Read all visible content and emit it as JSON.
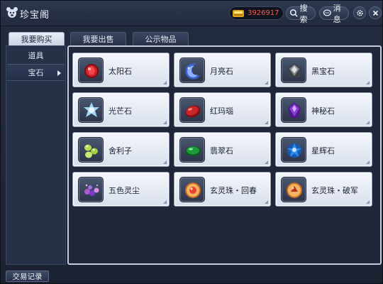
{
  "window": {
    "title": "珍宝阁"
  },
  "currency": {
    "value": "3926917",
    "icon": "gold-ingot-icon"
  },
  "header": {
    "search_label": "搜索",
    "message_label": "消息",
    "settings_icon": "gear-icon",
    "close_icon": "close-icon"
  },
  "tabs": [
    {
      "label": "我要购买",
      "active": true
    },
    {
      "label": "我要出售",
      "active": false
    },
    {
      "label": "公示物品",
      "active": false
    }
  ],
  "sidebar": {
    "items": [
      {
        "label": "道具",
        "selected": false
      },
      {
        "label": "宝石",
        "selected": true
      }
    ]
  },
  "items": [
    {
      "name": "太阳石",
      "icon": "sun-stone-icon",
      "color": "#d3202a"
    },
    {
      "name": "月亮石",
      "icon": "moon-stone-icon",
      "color": "#3f63d8"
    },
    {
      "name": "黑宝石",
      "icon": "black-gem-icon",
      "color": "#6d6f78"
    },
    {
      "name": "光芒石",
      "icon": "radiance-stone-icon",
      "color": "#9fd8f2"
    },
    {
      "name": "红玛瑙",
      "icon": "red-agate-icon",
      "color": "#c9262a"
    },
    {
      "name": "神秘石",
      "icon": "mystery-stone-icon",
      "color": "#8a3bd0"
    },
    {
      "name": "舍利子",
      "icon": "sarira-icon",
      "color": "#b6dc5a"
    },
    {
      "name": "翡翠石",
      "icon": "jade-stone-icon",
      "color": "#1f9a3a"
    },
    {
      "name": "星辉石",
      "icon": "star-stone-icon",
      "color": "#2f8fe8"
    },
    {
      "name": "五色灵尘",
      "icon": "five-color-dust-icon",
      "color": "#b25ad6"
    },
    {
      "name": "玄灵珠・回春",
      "icon": "spirit-orb-rejuvenate-icon",
      "color": "#e88a2a"
    },
    {
      "name": "玄灵珠・破军",
      "icon": "spirit-orb-breaker-icon",
      "color": "#e88a2a"
    }
  ],
  "footer": {
    "trade_history_label": "交易记录"
  }
}
